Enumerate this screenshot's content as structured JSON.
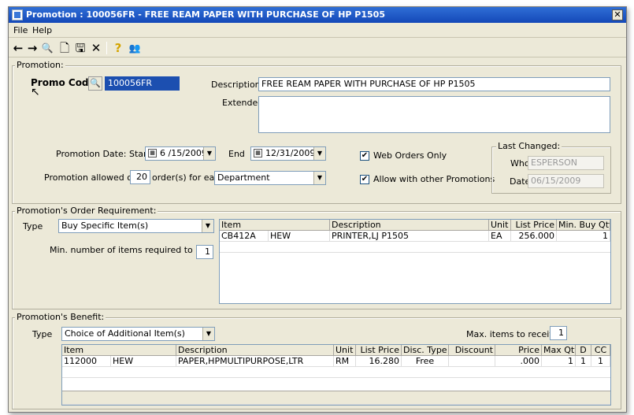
{
  "window": {
    "title": "Promotion : 100056FR  - FREE REAM PAPER WITH PURCHASE OF  HP P1505",
    "close_glyph": "✕"
  },
  "menu": {
    "file": "File",
    "help": "Help"
  },
  "toolbar": {
    "back_glyph": "←",
    "forward_glyph": "→",
    "find_glyph": "🔍",
    "new_glyph": "🗋",
    "save_glyph": "🖫",
    "delete_glyph": "✕",
    "help_glyph": "?",
    "people_glyph": "👥"
  },
  "promotion": {
    "legend": "Promotion:",
    "promo_code_label": "Promo Code",
    "promo_code_value": "100056FR",
    "description_label": "Description",
    "description_value": "FREE REAM PAPER WITH PURCHASE OF  HP P1505",
    "extended_label": "Extended",
    "extended_value": "",
    "date_start_label": "Promotion Date: Start",
    "date_start_value": "6 /15/2009",
    "date_end_label": "End",
    "date_end_value": "12/31/2009",
    "allowed_label": "Promotion allowed on",
    "allowed_value": "20",
    "orders_for_each_label": "order(s) for each",
    "for_each_value": "Department",
    "web_orders_label": "Web Orders Only",
    "web_orders_checked": true,
    "allow_other_label": "Allow with other Promotions",
    "allow_other_checked": true,
    "last_changed": {
      "legend": "Last Changed:",
      "who_label": "Who",
      "who_value": "ESPERSON",
      "date_label": "Date",
      "date_value": "06/15/2009"
    }
  },
  "requirement": {
    "legend": "Promotion's Order Requirement:",
    "type_label": "Type",
    "type_value": "Buy Specific Item(s)",
    "min_label": "Min. number of items required to buy",
    "min_value": "1",
    "headers": [
      "Item",
      "Description",
      "Unit",
      "List Price",
      "Min. Buy Qty"
    ],
    "rows": [
      {
        "item": "CB412A",
        "vendor": "HEW",
        "description": "PRINTER,LJ P1505",
        "unit": "EA",
        "list_price": "256.000",
        "min_buy": "1"
      }
    ]
  },
  "benefit": {
    "legend": "Promotion's Benefit:",
    "type_label": "Type",
    "type_value": "Choice of Additional Item(s)",
    "max_label": "Max. items to receive",
    "max_value": "1",
    "headers": [
      "Item",
      "Description",
      "Unit",
      "List Price",
      "Disc. Type",
      "Discount",
      "Price",
      "Max Qty",
      "D",
      "CC"
    ],
    "rows": [
      {
        "item": "112000",
        "vendor": "HEW",
        "description": "PAPER,HPMULTIPURPOSE,LTR",
        "unit": "RM",
        "list_price": "16.280",
        "disc_type": "Free",
        "discount": "",
        "price": ".000",
        "max_qty": "1",
        "d": "1",
        "cc": "1"
      }
    ]
  }
}
